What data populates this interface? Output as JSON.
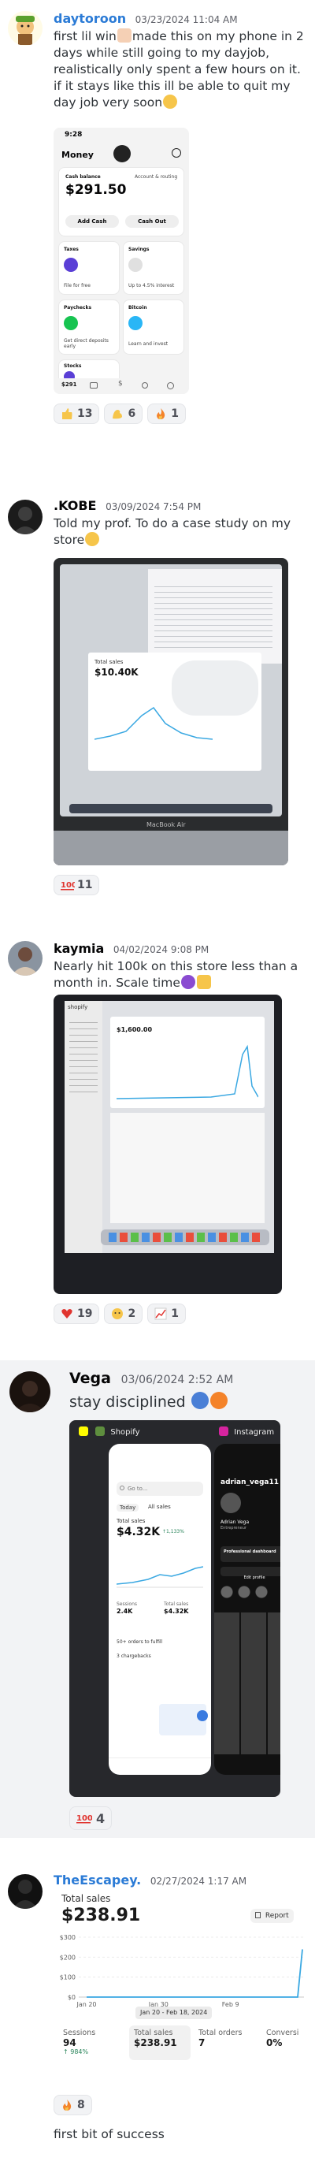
{
  "messages": [
    {
      "username": "daytoroon",
      "username_color": "#2b7bd6",
      "timestamp": "03/23/2024 11:04 AM",
      "text_parts": [
        "first lil win",
        "made this on my phone in 2 days while still going to my dayjob, realistically only spent a few hours on it. if it stays like this ill be able to quit my day job very soon"
      ],
      "phone": {
        "time": "9:28",
        "title": "Money",
        "cash_balance_label": "Cash balance",
        "account_routing": "Account & routing",
        "balance": "$291.50",
        "add_cash": "Add Cash",
        "cash_out": "Cash Out",
        "taxes_label": "Taxes",
        "taxes_sub": "File for free",
        "savings_label": "Savings",
        "savings_sub": "Up to 4.5% interest",
        "paychecks_label": "Paychecks",
        "paychecks_sub": "Get direct deposits early",
        "bitcoin_label": "Bitcoin",
        "bitcoin_sub": "Learn and invest",
        "stocks_label": "Stocks",
        "tab_balance": "$291"
      },
      "reactions": [
        {
          "icon": "thumbs-up-icon",
          "count": "13",
          "color": "#f6c54a"
        },
        {
          "icon": "flexed-biceps-icon",
          "count": "6",
          "color": "#f6c54a"
        },
        {
          "icon": "fire-icon",
          "count": "1",
          "color": "#f4832a"
        }
      ]
    },
    {
      "username": ".KOBE",
      "username_color": "#060607",
      "timestamp": "03/09/2024 7:54 PM",
      "text": "Told my prof. To do a case study on my store",
      "laptop": {
        "sales_label": "Total sales",
        "sales_value": "$10.40K",
        "brand": "MacBook Air"
      },
      "reactions": [
        {
          "icon": "hundred-points-icon",
          "count": "11",
          "color": "#e0342f"
        }
      ]
    },
    {
      "username": "kaymia",
      "username_color": "#060607",
      "timestamp": "04/02/2024 9:08 PM",
      "text": "Nearly hit 100k on this store less than a month in. Scale time",
      "monitor": {
        "brand": "shopify",
        "sales_value": "$1,600.00"
      },
      "reactions": [
        {
          "icon": "red-heart-icon",
          "count": "19",
          "color": "#e0342f"
        },
        {
          "icon": "face-holding-back-tears-icon",
          "count": "2",
          "color": "#f6c54a"
        },
        {
          "icon": "chart-increasing-icon",
          "count": "1",
          "color": "#e0342f"
        }
      ]
    },
    {
      "username": "Vega",
      "username_color": "#060607",
      "timestamp": "03/06/2024 2:52 AM",
      "text": "stay disciplined",
      "phone": {
        "app1": "Shopify",
        "app2": "Instagram",
        "search": "Go to...",
        "filter": "Today",
        "channels": "All sales",
        "sales_label": "Total sales",
        "sales_value": "$4.32K",
        "sales_change": "↑1,133%",
        "metric1_label": "Sessions",
        "metric1_value": "2.4K",
        "metric2_label": "Total sales",
        "metric2_value": "$4.32K",
        "insta_user": "adrian_vega11",
        "insta_name": "Adrian Vega",
        "insta_sub": "Entrepreneur",
        "insta_dash": "Professional dashboard",
        "insta_edit": "Edit profile",
        "task1": "50+ orders to fulfill",
        "task2": "3 chargebacks"
      },
      "reactions": [
        {
          "icon": "hundred-points-icon",
          "count": "4",
          "color": "#e0342f"
        }
      ]
    },
    {
      "username": "TheEscapey.",
      "username_color": "#2b7bd6",
      "timestamp": "02/27/2024 1:17 AM",
      "text": "first bit of success",
      "shopify": {
        "title": "Total sales",
        "value": "$238.91",
        "report": "Report",
        "date_range": "Jan 20 - Feb 18, 2024",
        "metrics": [
          {
            "label": "Sessions",
            "value": "94",
            "sub": "↑ 984%"
          },
          {
            "label": "Total sales",
            "value": "$238.91",
            "sub": ""
          },
          {
            "label": "Total orders",
            "value": "7",
            "sub": ""
          },
          {
            "label": "Conversi",
            "value": "0%",
            "sub": ""
          }
        ]
      },
      "reactions": [
        {
          "icon": "fire-icon",
          "count": "8",
          "color": "#f4832a"
        }
      ]
    }
  ],
  "chart_data": {
    "type": "line",
    "title": "Total sales",
    "x": [
      "Jan 20",
      "Jan 30",
      "Feb 9",
      "Feb 18"
    ],
    "series": [
      {
        "values": [
          0,
          0,
          0,
          239
        ]
      }
    ],
    "y_ticks": [
      "$300",
      "$200",
      "$100",
      "$0"
    ],
    "x_ticks": [
      "Jan 20",
      "Jan 30",
      "Feb 9"
    ],
    "ylim": [
      0,
      300
    ],
    "grid": true,
    "color": "#3aa8e2"
  }
}
